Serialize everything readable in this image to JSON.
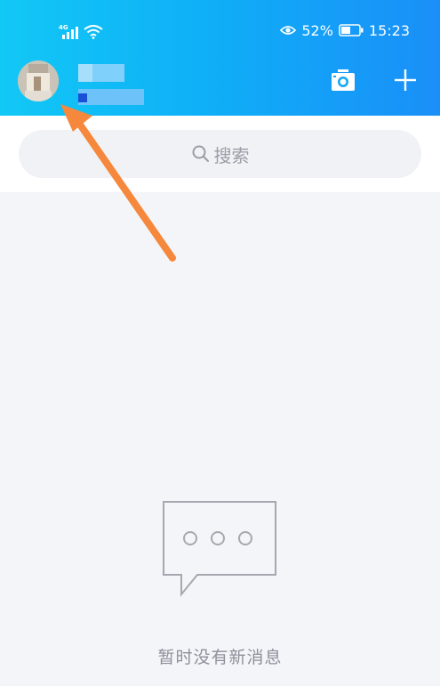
{
  "status_bar": {
    "network": "4G",
    "battery_percent": "52%",
    "time": "15:23"
  },
  "profile": {
    "avatar": "avatar-blurred",
    "nickname": "",
    "status": ""
  },
  "header_actions": {
    "camera_icon": "camera-icon",
    "add_icon": "plus-icon"
  },
  "search": {
    "placeholder": "搜索",
    "icon": "search-icon"
  },
  "empty_state": {
    "icon": "chat-bubble-icon",
    "message": "暂时没有新消息"
  },
  "annotation": {
    "arrow_color": "#f5883c"
  },
  "colors": {
    "header_start": "#12c8f5",
    "header_end": "#1a8ff8",
    "background": "#f4f5f9"
  }
}
